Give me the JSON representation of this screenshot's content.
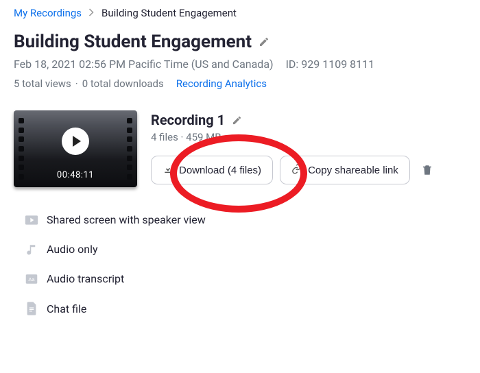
{
  "breadcrumb": {
    "root": "My Recordings",
    "current": "Building Student Engagement"
  },
  "title": "Building Student Engagement",
  "datetime": "Feb 18, 2021 02:56 PM Pacific Time (US and Canada)",
  "id_label": "ID: 929 1109 8111",
  "stats": {
    "views": "5 total views",
    "downloads": "0 total downloads",
    "analytics": "Recording Analytics"
  },
  "recording": {
    "title": "Recording 1",
    "meta": "4 files · 459 MB",
    "duration": "00:48:11",
    "download_btn": "Download (4 files)",
    "share_btn": "Copy shareable link"
  },
  "files": {
    "f0": "Shared screen with speaker view",
    "f1": "Audio only",
    "f2": "Audio transcript",
    "f3": "Chat file"
  }
}
